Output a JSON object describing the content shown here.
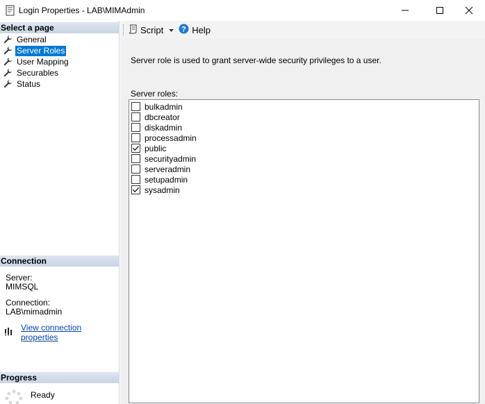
{
  "window": {
    "title": "Login Properties - LAB\\MIMAdmin"
  },
  "left": {
    "select_page_header": "Select a page",
    "nav_items": [
      {
        "label": "General",
        "selected": false
      },
      {
        "label": "Server Roles",
        "selected": true
      },
      {
        "label": "User Mapping",
        "selected": false
      },
      {
        "label": "Securables",
        "selected": false
      },
      {
        "label": "Status",
        "selected": false
      }
    ],
    "connection_header": "Connection",
    "server_label": "Server:",
    "server_value": "MIMSQL",
    "connection_label": "Connection:",
    "connection_value": "LAB\\mimadmin",
    "view_connection_link": "View connection properties",
    "progress_header": "Progress",
    "progress_status": "Ready"
  },
  "toolbar": {
    "script_label": "Script",
    "help_label": "Help"
  },
  "main": {
    "description": "Server role is used to grant server-wide security privileges to a user.",
    "roles_label": "Server roles:",
    "roles": [
      {
        "name": "bulkadmin",
        "checked": false
      },
      {
        "name": "dbcreator",
        "checked": false
      },
      {
        "name": "diskadmin",
        "checked": false
      },
      {
        "name": "processadmin",
        "checked": false
      },
      {
        "name": "public",
        "checked": true
      },
      {
        "name": "securityadmin",
        "checked": false
      },
      {
        "name": "serveradmin",
        "checked": false
      },
      {
        "name": "setupadmin",
        "checked": false
      },
      {
        "name": "sysadmin",
        "checked": true
      }
    ]
  }
}
